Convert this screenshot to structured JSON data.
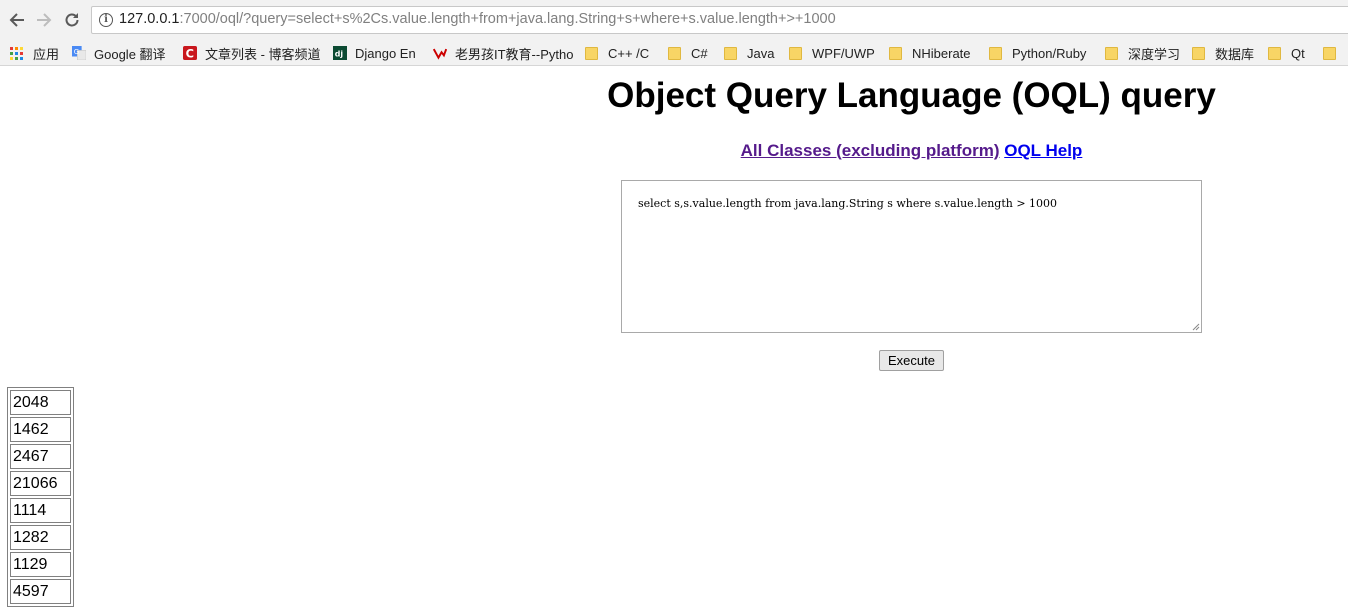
{
  "browser": {
    "url_host": "127.0.0.1",
    "url_rest": ":7000/oql/?query=select+s%2Cs.value.length+from+java.lang.String+s+where+s.value.length+>+1000"
  },
  "bookmarks": [
    {
      "label": "应用",
      "icon": "apps-grid-icon"
    },
    {
      "label": "Google 翻译",
      "icon": "google-translate-icon"
    },
    {
      "label": "文章列表 - 博客频道",
      "icon": "csdn-icon",
      "color": "#c9171d"
    },
    {
      "label": "Django En",
      "icon": "django-icon",
      "color": "#0c4b33"
    },
    {
      "label": "老男孩IT教育--Pytho",
      "icon": "oldboy-icon"
    },
    {
      "label": "C++ /C",
      "icon": "folder-icon"
    },
    {
      "label": "C#",
      "icon": "folder-icon"
    },
    {
      "label": "Java",
      "icon": "folder-icon"
    },
    {
      "label": "WPF/UWP",
      "icon": "folder-icon"
    },
    {
      "label": "NHiberate",
      "icon": "folder-icon"
    },
    {
      "label": "Python/Ruby",
      "icon": "folder-icon"
    },
    {
      "label": "深度学习",
      "icon": "folder-icon"
    },
    {
      "label": "数据库",
      "icon": "folder-icon"
    },
    {
      "label": "Qt",
      "icon": "folder-icon"
    }
  ],
  "page": {
    "title": "Object Query Language (OQL) query",
    "links": {
      "all_classes": "All Classes (excluding platform)",
      "oql_help": "OQL Help"
    },
    "query_text": "select s,s.value.length from java.lang.String s where s.value.length > 1000",
    "execute_label": "Execute"
  },
  "results": [
    "2048",
    "1462",
    "2467",
    "21066",
    "1114",
    "1282",
    "1129",
    "4597"
  ]
}
